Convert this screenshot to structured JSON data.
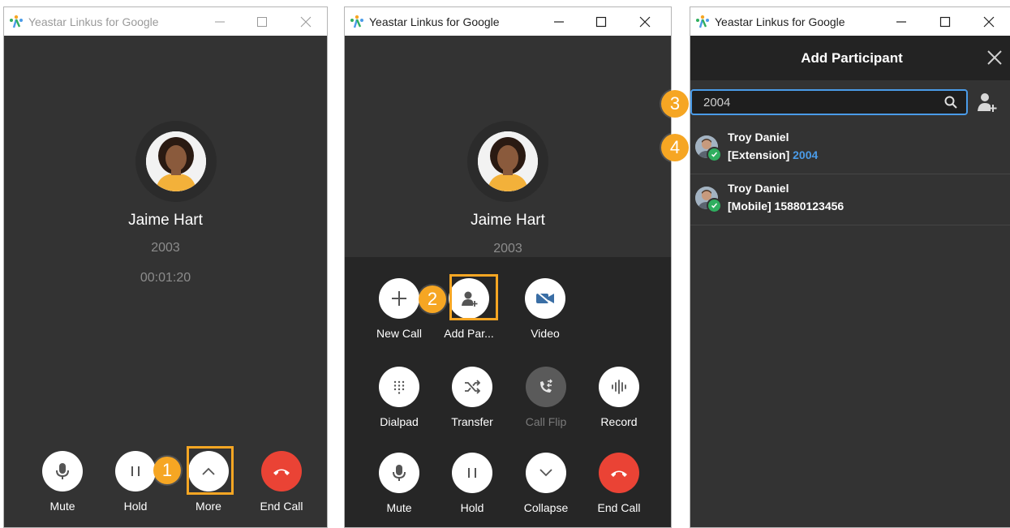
{
  "app": {
    "title": "Yeastar Linkus for Google"
  },
  "colors": {
    "accent_orange": "#f6a623",
    "end_call_red": "#ea4335",
    "link_blue": "#4a9be8",
    "presence_green": "#2fae5f"
  },
  "call": {
    "name": "Jaime Hart",
    "number": "2003",
    "duration": "00:01:20"
  },
  "controls": {
    "mute": "Mute",
    "hold": "Hold",
    "more": "More",
    "end_call": "End Call",
    "new_call": "New Call",
    "add_participant": "Add Par...",
    "video": "Video",
    "dialpad": "Dialpad",
    "transfer": "Transfer",
    "call_flip": "Call Flip",
    "record": "Record",
    "collapse": "Collapse"
  },
  "steps": {
    "s1": "1",
    "s2": "2",
    "s3": "3",
    "s4": "4"
  },
  "add_participant": {
    "title": "Add Participant",
    "search_value": "2004",
    "results": [
      {
        "name": "Troy Daniel",
        "type": "[Extension]",
        "number": "2004"
      },
      {
        "name": "Troy Daniel",
        "type": "[Mobile]",
        "number": "15880123456"
      }
    ]
  }
}
